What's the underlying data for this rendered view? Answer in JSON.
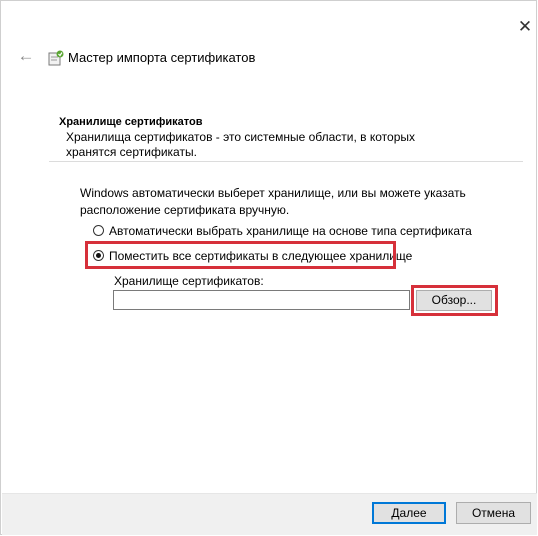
{
  "window": {
    "title": "Мастер импорта сертификатов",
    "close_glyph": "✕",
    "back_glyph": "←"
  },
  "section": {
    "title": "Хранилище сертификатов",
    "description": "Хранилища сертификатов - это системные области, в которых хранятся сертификаты."
  },
  "info_text": "Windows автоматически выберет хранилище, или вы можете указать расположение сертификата вручную.",
  "options": [
    {
      "label": "Автоматически выбрать хранилище на основе типа сертификата",
      "checked": false
    },
    {
      "label": "Поместить все сертификаты в следующее хранилище",
      "checked": true
    }
  ],
  "store": {
    "label": "Хранилище сертификатов:",
    "value": "",
    "browse_label": "Обзор..."
  },
  "footer": {
    "next_label": "Далее",
    "cancel_label": "Отмена"
  },
  "colors": {
    "highlight": "#d6303a",
    "focus_border": "#0078d7"
  }
}
